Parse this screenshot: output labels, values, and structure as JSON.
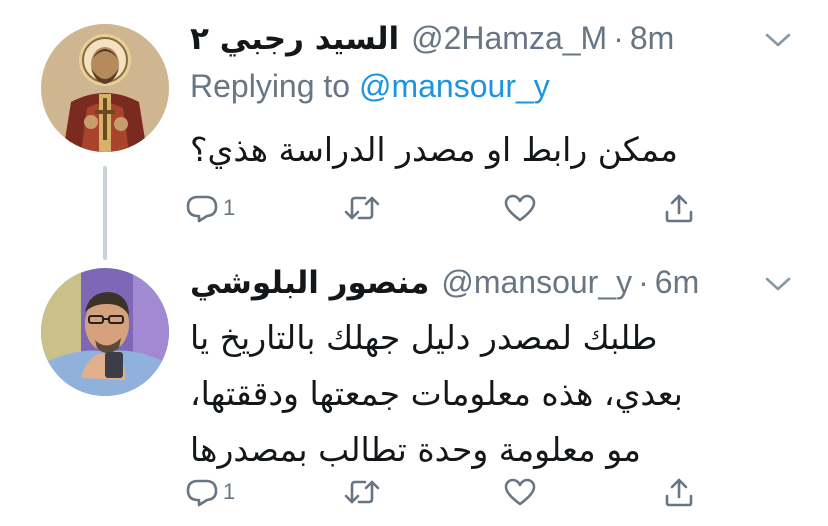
{
  "tweets": [
    {
      "display_name": "السيد رجبي ٢",
      "handle": "@2Hamza_M",
      "separator": "·",
      "time": "8m",
      "replying_prefix": "Replying to",
      "replying_to": "@mansour_y",
      "text_lines": [
        "ممكن رابط او مصدر الدراسة هذي؟"
      ],
      "reply_count": "1",
      "avatar_icon": "icon-painting-avatar"
    },
    {
      "display_name": "منصور البلوشي",
      "handle": "@mansour_y",
      "separator": "·",
      "time": "6m",
      "text_lines": [
        "طلبك لمصدر دليل جهلك بالتاريخ يا",
        "بعدي، هذه معلومات جمعتها ودققتها،",
        "مو معلومة وحدة تطالب بمصدرها"
      ],
      "reply_count": "1",
      "avatar_icon": "man-photo-avatar"
    }
  ],
  "icons": {
    "reply": "reply-bubble-icon",
    "retweet": "retweet-icon",
    "like": "heart-icon",
    "share": "share-upload-icon",
    "menu": "chevron-down-icon"
  },
  "colors": {
    "text": "#14171a",
    "secondary": "#687684",
    "link": "#1b95e0",
    "thread_line": "#c9d3da"
  }
}
